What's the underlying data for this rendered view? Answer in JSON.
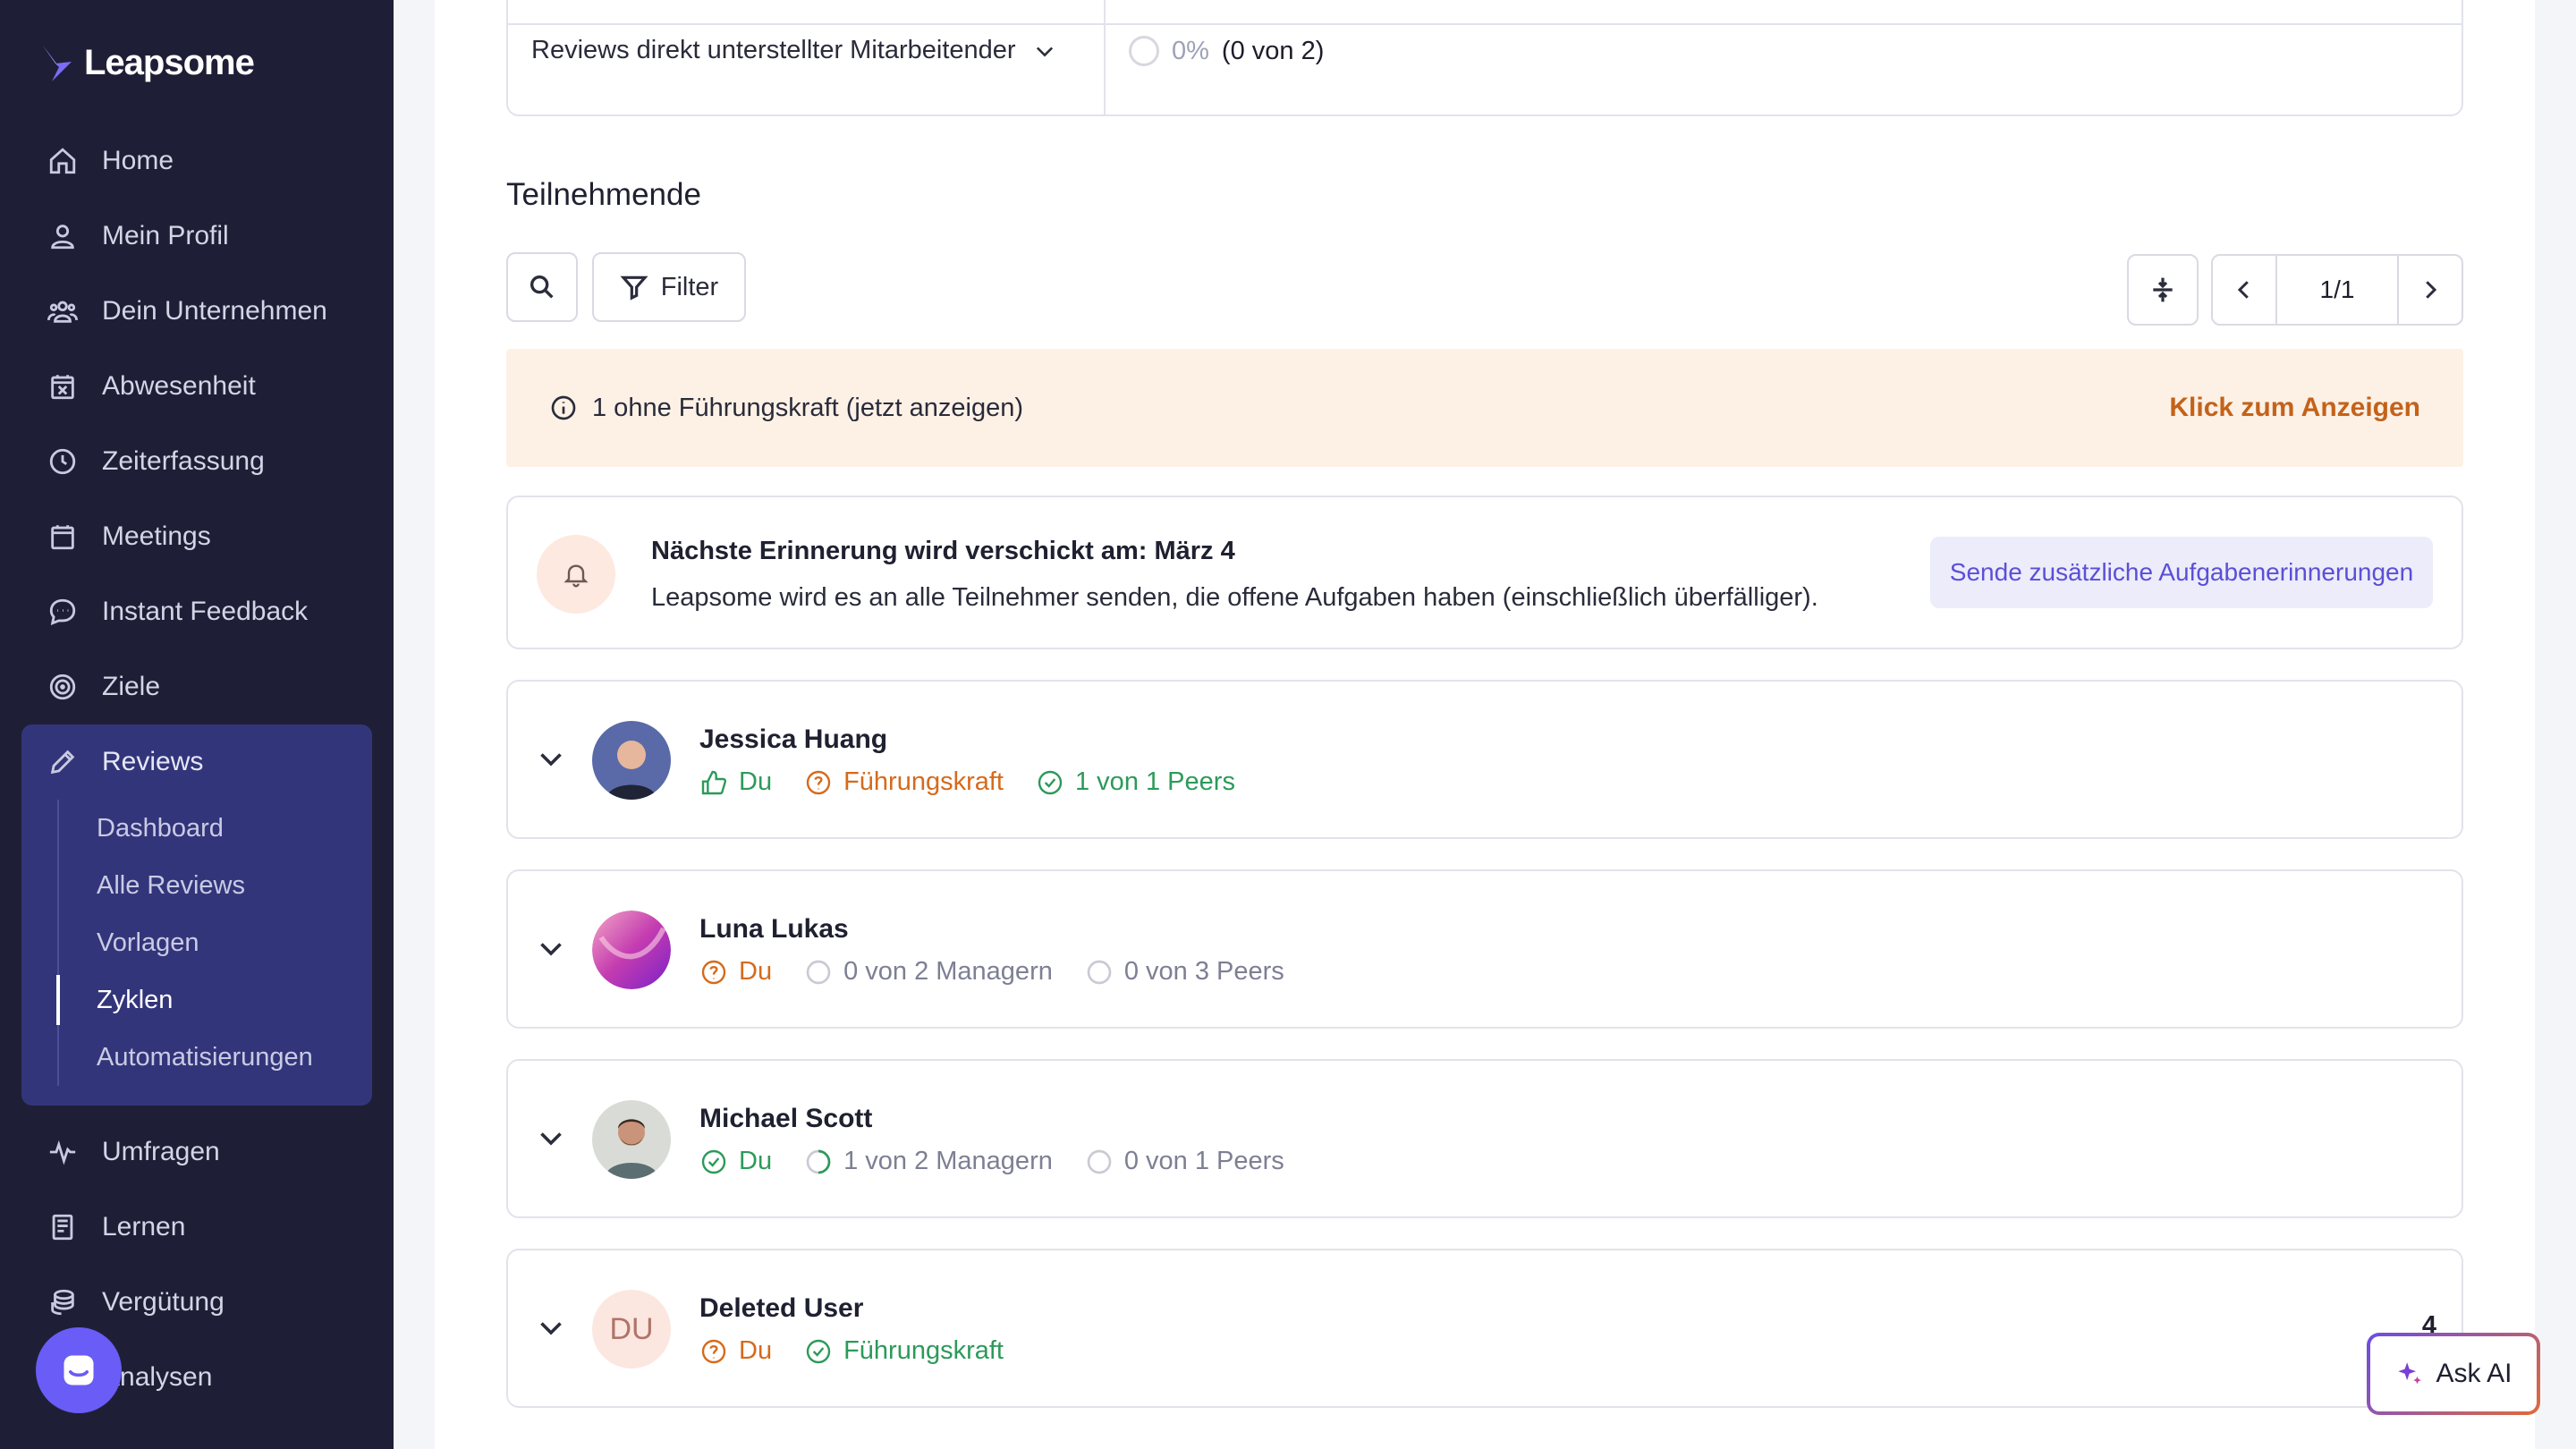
{
  "app": {
    "name": "Leapsome"
  },
  "sidebar": {
    "items": [
      {
        "label": "Home",
        "icon": "home-icon"
      },
      {
        "label": "Mein Profil",
        "icon": "user-icon"
      },
      {
        "label": "Dein Unternehmen",
        "icon": "people-icon"
      },
      {
        "label": "Abwesenheit",
        "icon": "calendar-x-icon"
      },
      {
        "label": "Zeiterfassung",
        "icon": "clock-icon"
      },
      {
        "label": "Meetings",
        "icon": "calendar-icon"
      },
      {
        "label": "Instant Feedback",
        "icon": "chat-icon"
      },
      {
        "label": "Ziele",
        "icon": "target-icon"
      }
    ],
    "reviews": {
      "label": "Reviews",
      "icon": "pencil-icon",
      "sub": [
        {
          "label": "Dashboard"
        },
        {
          "label": "Alle Reviews"
        },
        {
          "label": "Vorlagen"
        },
        {
          "label": "Zyklen",
          "active": true
        },
        {
          "label": "Automatisierungen"
        }
      ]
    },
    "items_after": [
      {
        "label": "Umfragen",
        "icon": "pulse-icon"
      },
      {
        "label": "Lernen",
        "icon": "book-icon"
      },
      {
        "label": "Vergütung",
        "icon": "coins-icon"
      },
      {
        "label": "Analysen",
        "icon": "chart-icon"
      }
    ]
  },
  "top_table": {
    "row_label": "Reviews direkt unterstellter Mitarbeitender",
    "percent": "0%",
    "count": "(0 von 2)"
  },
  "participants": {
    "title": "Teilnehmende",
    "filter_label": "Filter",
    "pager": "1/1"
  },
  "banner": {
    "text": "1 ohne Führungskraft (jetzt anzeigen)",
    "link": "Klick zum Anzeigen"
  },
  "reminder": {
    "title": "Nächste Erinnerung wird verschickt am: März 4",
    "text": "Leapsome wird es an alle Teilnehmer senden, die offene Aufgaben haben (einschließlich überfälliger).",
    "button": "Sende zusätzliche Aufgabenerinnerungen"
  },
  "people": [
    {
      "name": "Jessica Huang",
      "statuses": [
        {
          "label": "Du",
          "state": "thumb",
          "color": "green"
        },
        {
          "label": "Führungskraft",
          "state": "question",
          "color": "orange"
        },
        {
          "label": "1 von 1 Peers",
          "state": "done",
          "color": "green"
        }
      ]
    },
    {
      "name": "Luna Lukas",
      "statuses": [
        {
          "label": "Du",
          "state": "question",
          "color": "orange"
        },
        {
          "label": "0 von 2 Managern",
          "state": "empty",
          "color": "grey"
        },
        {
          "label": "0 von 3 Peers",
          "state": "empty",
          "color": "grey"
        }
      ]
    },
    {
      "name": "Michael Scott",
      "statuses": [
        {
          "label": "Du",
          "state": "done",
          "color": "green"
        },
        {
          "label": "1 von 2 Managern",
          "state": "partial",
          "color": "grey"
        },
        {
          "label": "0 von 1 Peers",
          "state": "empty",
          "color": "grey"
        }
      ]
    },
    {
      "name": "Deleted User",
      "initials": "DU",
      "badge": "4",
      "statuses": [
        {
          "label": "Du",
          "state": "question",
          "color": "orange"
        },
        {
          "label": "Führungskraft",
          "state": "done",
          "color": "green"
        }
      ]
    }
  ],
  "ask_ai": {
    "label": "Ask AI"
  }
}
